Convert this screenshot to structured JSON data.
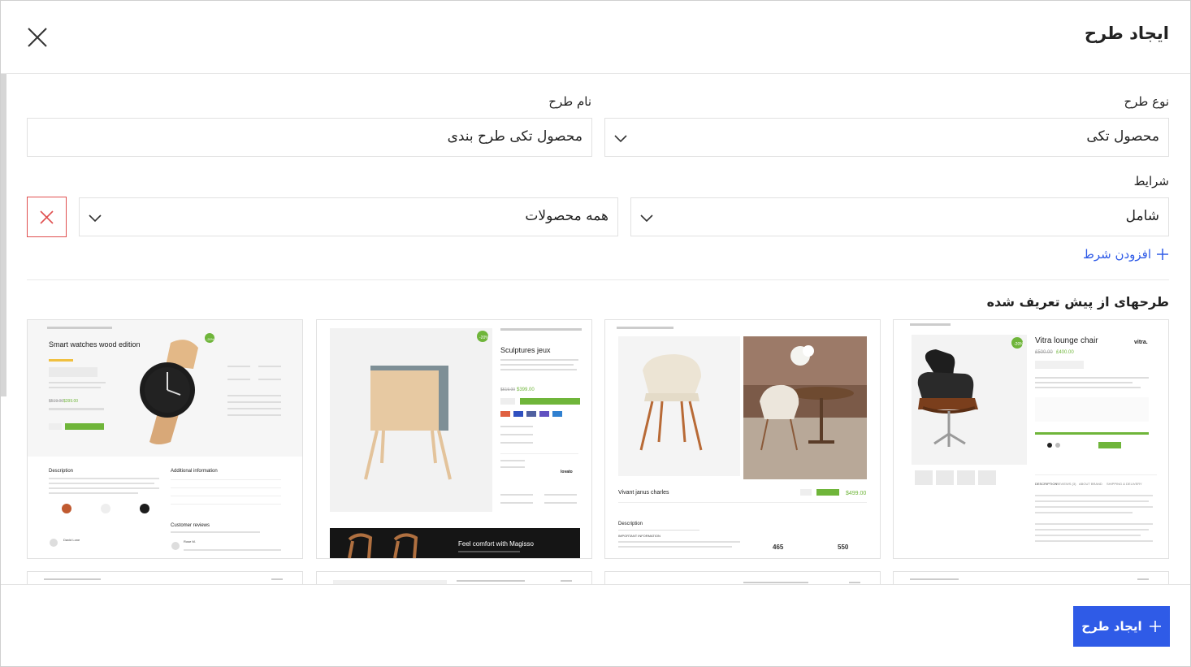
{
  "header": {
    "title": "ایجاد طرح"
  },
  "form": {
    "type_label": "نوع طرح",
    "type_value": "محصول تکی",
    "name_label": "نام طرح",
    "name_value": "محصول تکی طرح بندی",
    "conditions_label": "شرایط",
    "condition_mode": "شامل",
    "condition_target": "همه محصولات",
    "add_condition": "افزودن شرط"
  },
  "templates": {
    "title": "طرحهای از پیش تعریف شده",
    "items": [
      {
        "heading": "Vitra lounge chair",
        "brand": "vitra.",
        "price_old": "£500.00",
        "price_new": "£400.00",
        "badge": "-20%",
        "tabs": [
          "DESCRIPTION",
          "REVIEWS (3)",
          "ABOUT BRAND",
          "SHIPPING & DELIVERY"
        ]
      },
      {
        "heading": "Vivant janus charles",
        "price_new": "$499.00",
        "desc_title": "Description",
        "sub_title": "IMPORTANT INFORMATION",
        "num_a": "465",
        "num_b": "550"
      },
      {
        "heading": "Sculptures jeux",
        "price_old": "$619.00",
        "price_new": "$399.00",
        "badge": "-20%",
        "banner_text": "Feel comfort with Magisso",
        "brand": "lovato"
      },
      {
        "heading": "Smart watches wood edition",
        "badge": "-20%",
        "price_old": "$519.00",
        "price_new": "$399.00",
        "desc_title": "Description",
        "info_title": "Additional information",
        "reviews_title": "Customer reviews",
        "reviewer_a": "David Lone",
        "reviewer_b": "Rose M."
      }
    ]
  },
  "footer": {
    "create_label": "ایجاد طرح"
  },
  "colors": {
    "accent": "#2f5be7",
    "danger": "#e05050",
    "green": "#6fb53a"
  }
}
